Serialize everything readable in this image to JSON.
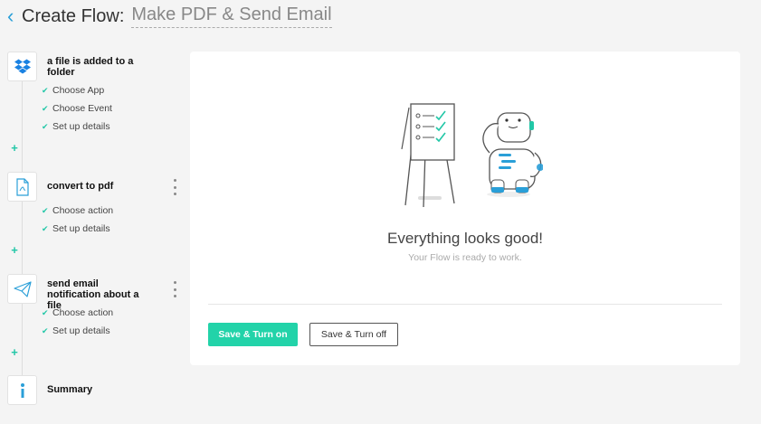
{
  "header": {
    "back_icon": "chevron-left-icon",
    "title": "Create Flow:",
    "flow_name": "Make PDF & Send Email"
  },
  "steps": [
    {
      "icon": "dropbox-icon",
      "title": "a file is added to a folder",
      "substeps": [
        "Choose App",
        "Choose Event",
        "Set up details"
      ]
    },
    {
      "icon": "pdf-file-icon",
      "title": "convert to pdf",
      "substeps": [
        "Choose action",
        "Set up details"
      ]
    },
    {
      "icon": "paper-plane-icon",
      "title": "send email notification about a file",
      "substeps": [
        "Choose action",
        "Set up details"
      ]
    },
    {
      "icon": "info-icon",
      "title": "Summary",
      "substeps": []
    }
  ],
  "main": {
    "headline": "Everything looks good!",
    "subline": "Your Flow is ready to work.",
    "primary_button": "Save & Turn on",
    "secondary_button": "Save & Turn off"
  },
  "colors": {
    "accent": "#22d3a9",
    "link": "#2a9fd8",
    "background": "#f4f4f4"
  }
}
